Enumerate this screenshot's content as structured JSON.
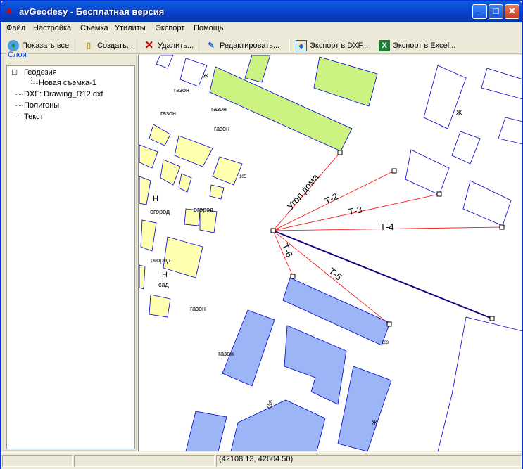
{
  "window": {
    "title": "avGeodesy - Бесплатная версия",
    "icon": "app-logo-icon"
  },
  "menu": [
    "Файл",
    "Настройка",
    "Съемка",
    "Утилиты",
    "Экспорт",
    "Помощь"
  ],
  "toolbar": {
    "show_all": "Показать все",
    "create": "Создать...",
    "delete": "Удалить...",
    "edit": "Редактировать...",
    "export_dxf": "Экспорт в DXF...",
    "export_excel": "Экспорт в Excel..."
  },
  "layers": {
    "title": "Слои",
    "geodesy": "Геодезия",
    "survey": "Новая съемка-1",
    "dxf": "DXF: Drawing_R12.dxf",
    "polygons": "Полигоны",
    "text": "Текст",
    "expander": "⊟"
  },
  "map": {
    "measurements": {
      "corner": "Угол дома",
      "t2": "Т-2",
      "t3": "Т-3",
      "t4": "Т-4",
      "t5": "Т-5",
      "t6": "Т-6"
    },
    "labels": {
      "gazon": "газон",
      "ogorod": "огород",
      "sad": "сад",
      "n": "Н",
      "zh": "Ж",
      "k": "К",
      "n20": "20",
      "n103": "103",
      "n105": "105"
    },
    "colors": {
      "green": "#ccf281",
      "yellow": "#ffffb0",
      "blue": "#9bb5f7",
      "outline": "#0000cc",
      "ray": "#ff0000",
      "line": "#1a0080"
    }
  },
  "status": {
    "coords": "(42108.13, 42604.50)"
  }
}
